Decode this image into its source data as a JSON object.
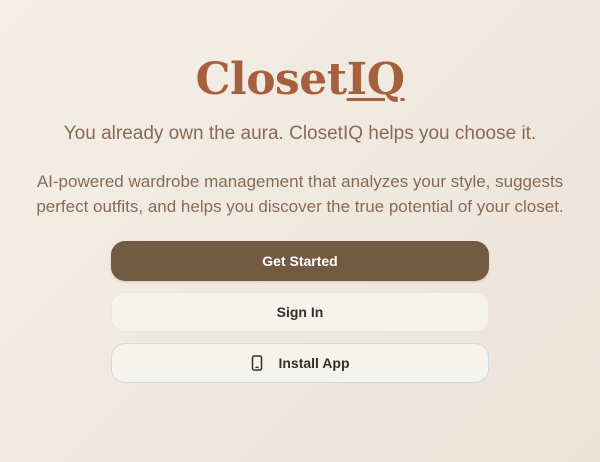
{
  "app": {
    "logo_text": "ClosetIQ"
  },
  "hero": {
    "tagline": "You already own the aura. ClosetIQ helps you choose it.",
    "description": "AI-powered wardrobe management that analyzes your style, suggests perfect outfits, and helps you discover the true potential of your closet."
  },
  "actions": {
    "get_started": "Get Started",
    "sign_in": "Sign In",
    "install_app": "Install App",
    "install_icon": "smartphone-icon"
  },
  "colors": {
    "brand": "#a6603e",
    "primary_button": "#735a42",
    "text_muted": "#8a6a52",
    "install_border": "#c9dbe6"
  }
}
